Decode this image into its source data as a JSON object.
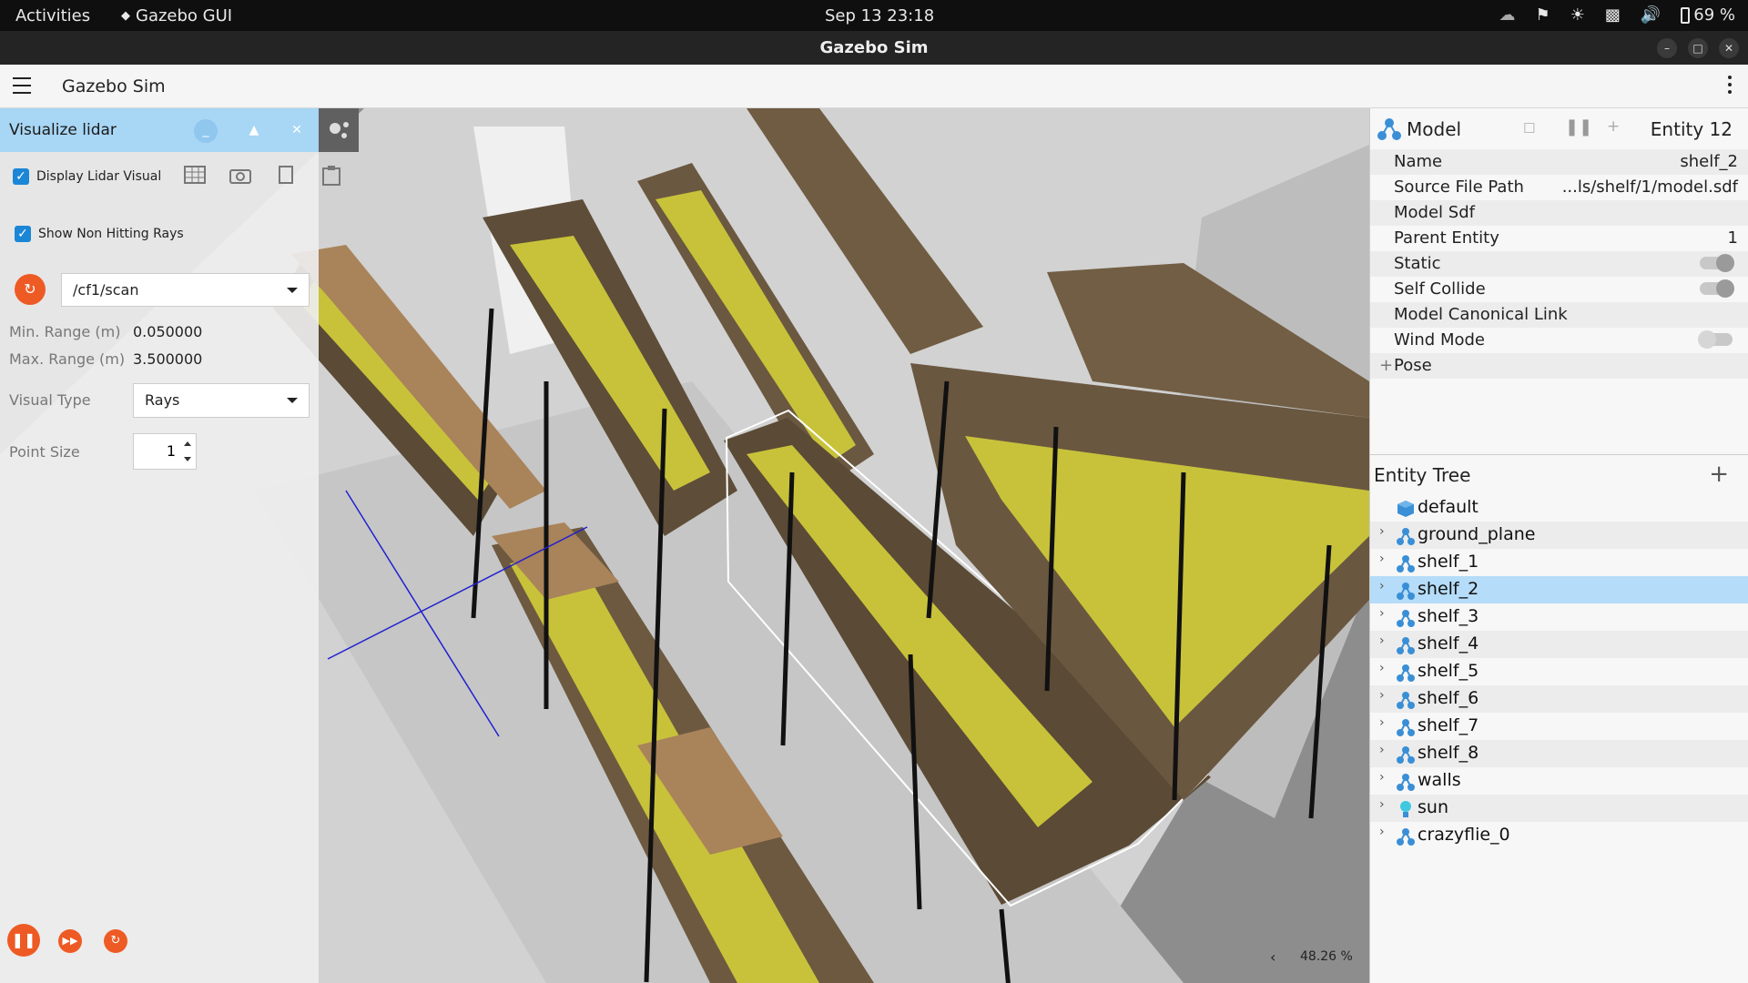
{
  "system_bar": {
    "activities": "Activities",
    "app_name": "Gazebo GUI",
    "clock": "Sep 13  23:18",
    "battery": "69 %"
  },
  "window": {
    "title": "Gazebo Sim"
  },
  "app_header": {
    "title": "Gazebo Sim"
  },
  "lidar_panel": {
    "title": "Visualize lidar",
    "display_lidar_visual": {
      "label": "Display Lidar Visual",
      "checked": true
    },
    "show_non_hitting_rays": {
      "label": "Show Non Hitting Rays",
      "checked": true
    },
    "topic": "/cf1/scan",
    "min_range_label": "Min. Range (m)",
    "min_range_value": "0.050000",
    "max_range_label": "Max. Range (m)",
    "max_range_value": "3.500000",
    "visual_type_label": "Visual Type",
    "visual_type_value": "Rays",
    "point_size_label": "Point Size",
    "point_size_value": "1"
  },
  "viewport": {
    "zoom": "48.26 %"
  },
  "component_inspector": {
    "title": "Model",
    "entity": "Entity 12",
    "rows": [
      {
        "key": "Name",
        "value": "shelf_2"
      },
      {
        "key": "Source File Path",
        "value": "...ls/shelf/1/model.sdf"
      },
      {
        "key": "Model Sdf",
        "value": ""
      },
      {
        "key": "Parent Entity",
        "value": "1"
      },
      {
        "key": "Static",
        "value": ""
      },
      {
        "key": "Self Collide",
        "value": ""
      },
      {
        "key": "Model Canonical Link",
        "value": ""
      },
      {
        "key": "Wind Mode",
        "value": ""
      }
    ],
    "pose_label": "Pose"
  },
  "entity_tree": {
    "title": "Entity Tree",
    "items": [
      {
        "name": "default",
        "icon": "world-cube-icon"
      },
      {
        "name": "ground_plane",
        "icon": "model-icon"
      },
      {
        "name": "shelf_1",
        "icon": "model-icon"
      },
      {
        "name": "shelf_2",
        "icon": "model-icon",
        "selected": true
      },
      {
        "name": "shelf_3",
        "icon": "model-icon"
      },
      {
        "name": "shelf_4",
        "icon": "model-icon"
      },
      {
        "name": "shelf_5",
        "icon": "model-icon"
      },
      {
        "name": "shelf_6",
        "icon": "model-icon"
      },
      {
        "name": "shelf_7",
        "icon": "model-icon"
      },
      {
        "name": "shelf_8",
        "icon": "model-icon"
      },
      {
        "name": "walls",
        "icon": "model-icon"
      },
      {
        "name": "sun",
        "icon": "light-bulb-icon"
      },
      {
        "name": "crazyflie_0",
        "icon": "model-icon"
      }
    ]
  },
  "colors": {
    "accent_orange": "#ee5a24",
    "selection_blue": "#b5dcf8",
    "panel_header_blue": "#a8d6f5",
    "shelf_yellow": "#c8c23a",
    "box_brown": "#a9835a"
  }
}
